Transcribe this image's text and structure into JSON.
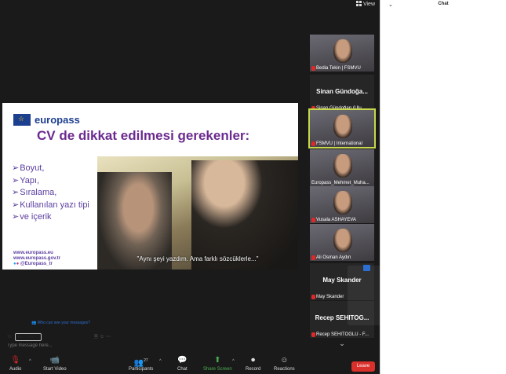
{
  "window": {
    "view_label": "View"
  },
  "slide": {
    "logo_text": "europass",
    "title": "CV de dikkat edilmesi gerekenler:",
    "bullets": [
      "Boyut,",
      "Yapı,",
      "Sıralama,",
      "Kullanılan yazı tipi",
      "ve içerik"
    ],
    "links": [
      "www.europass.eu",
      "www.europass.gov.tr",
      "@Europass_tr"
    ],
    "subtitle": "\"Aynı şeyi yazdım. Ama farklı sözcüklerle...\""
  },
  "participants": [
    {
      "name": "Bedia Tekin | FSMVU",
      "type": "video",
      "muted": true
    },
    {
      "name": "Sinan Gündoğan (Ulu...",
      "display_name": "Sinan  Gündoğa...",
      "type": "name",
      "muted": true
    },
    {
      "name": "FSMVU | International",
      "type": "video",
      "muted": true,
      "active": true
    },
    {
      "name": "Europass_Mehmet_Muha...",
      "type": "video",
      "muted": false
    },
    {
      "name": "Vusala ASHAYEVA",
      "type": "video",
      "muted": true
    },
    {
      "name": "Ali Osman Aydın",
      "type": "video",
      "muted": true
    },
    {
      "name": "May Skander",
      "display_name": "May Skander",
      "type": "name",
      "muted": true
    },
    {
      "name": "Recep SEHITOGLU - F...",
      "display_name": "Recep  SEHITOG...",
      "type": "name",
      "muted": true
    }
  ],
  "toolbar": {
    "audio": "Audio",
    "start_video": "Start Video",
    "participants": "Participants",
    "participants_count": "27",
    "chat": "Chat",
    "share_screen": "Share Screen",
    "record": "Record",
    "reactions": "Reactions",
    "leave": "Leave"
  },
  "chat": {
    "title": "Chat",
    "privacy_text": "Who can see your messages?",
    "to_label": "To:",
    "to_value": "Everyone",
    "input_placeholder": "Type message here..."
  },
  "colors": {
    "accent_green": "#4caf50",
    "leave_red": "#d9302b",
    "slide_title": "#6b2a8f",
    "active_border": "#c7d84a"
  }
}
